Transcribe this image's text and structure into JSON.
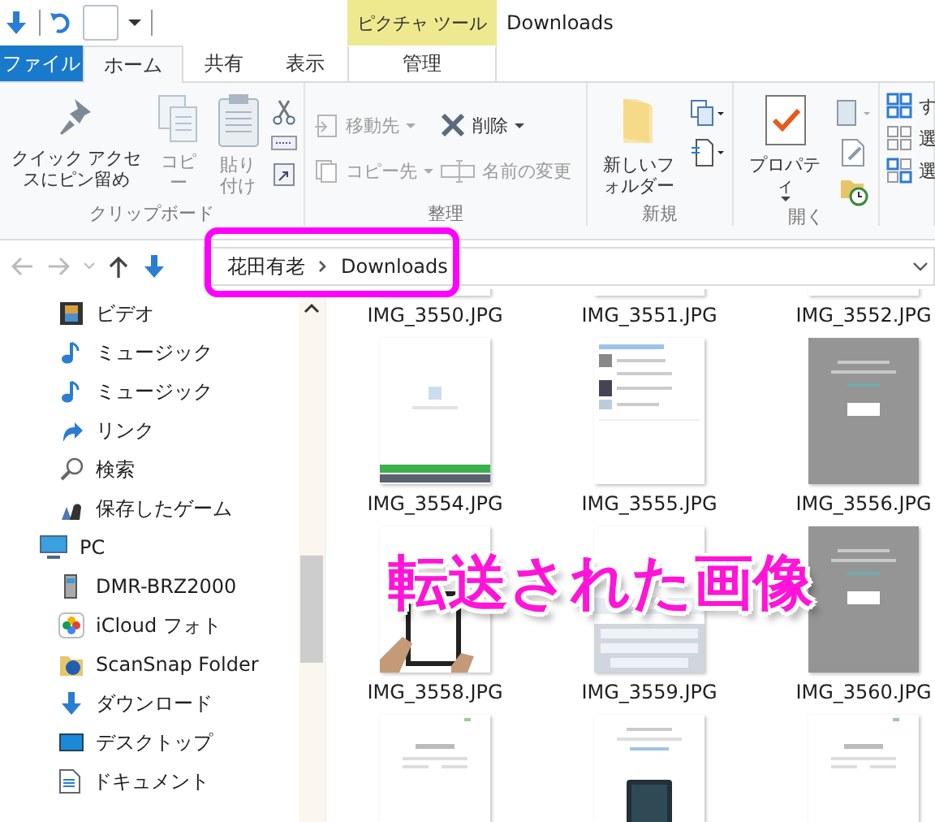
{
  "title_bar": {
    "contextual_group": "ピクチャ ツール",
    "title": "Downloads"
  },
  "tabs": [
    {
      "label": "ファイル",
      "kind": "file",
      "selected": false
    },
    {
      "label": "ホーム",
      "kind": "tab",
      "selected": true
    },
    {
      "label": "共有",
      "kind": "tab",
      "selected": false
    },
    {
      "label": "表示",
      "kind": "tab",
      "selected": false
    },
    {
      "label": "管理",
      "kind": "contextual",
      "selected": false
    }
  ],
  "ribbon": {
    "groups": [
      {
        "label": "クリップボード",
        "buttons": [
          {
            "kind": "large",
            "label": "クイック アクセスにピン留め",
            "disabled": false
          },
          {
            "kind": "large",
            "label": "コピー",
            "disabled": true
          },
          {
            "kind": "large",
            "label": "貼り付け",
            "disabled": true
          },
          {
            "kind": "stack"
          }
        ]
      },
      {
        "label": "整理",
        "buttons": [
          {
            "kind": "small",
            "label": "移動先",
            "dropdown": true,
            "disabled": true
          },
          {
            "kind": "small",
            "label": "コピー先",
            "dropdown": true,
            "disabled": true
          },
          {
            "kind": "small",
            "label": "削除",
            "dropdown": true,
            "disabled": false
          },
          {
            "kind": "small",
            "label": "名前の変更",
            "dropdown": false,
            "disabled": true
          }
        ]
      },
      {
        "label": "新規",
        "buttons": [
          {
            "kind": "large",
            "label": "新しいフォルダー",
            "dropdown": false,
            "disabled": false
          },
          {
            "kind": "stack"
          }
        ]
      },
      {
        "label": "開く",
        "buttons": [
          {
            "kind": "large",
            "label": "プロパティ",
            "dropdown": true,
            "disabled": false
          },
          {
            "kind": "stack"
          }
        ]
      },
      {
        "buttons": [
          {
            "kind": "small",
            "label": "す",
            "disabled": false
          },
          {
            "kind": "small",
            "label": "選",
            "disabled": false
          },
          {
            "kind": "small",
            "label": "選",
            "disabled": false
          }
        ]
      }
    ]
  },
  "address": {
    "breadcrumb": [
      {
        "label": "花田有老"
      },
      {
        "label": "Downloads"
      }
    ]
  },
  "sidebar": {
    "items_above": [
      {
        "label": "ビデオ"
      },
      {
        "label": "ミュージック"
      },
      {
        "label": "ミュージック"
      },
      {
        "label": "リンク"
      },
      {
        "label": "検索"
      },
      {
        "label": "保存したゲーム"
      }
    ],
    "tree": [
      {
        "label": "PC",
        "children": [
          {
            "label": "DMR-BRZ2000"
          },
          {
            "label": "iCloud フォト"
          },
          {
            "label": "ScanSnap Folder"
          },
          {
            "label": "ダウンロード"
          },
          {
            "label": "デスクトップ"
          },
          {
            "label": "ドキュメント"
          }
        ]
      }
    ]
  },
  "files": [
    {
      "kind": "picture",
      "name": "IMG_3550.JPG"
    },
    {
      "kind": "picture",
      "name": "IMG_3551.JPG"
    },
    {
      "kind": "picture",
      "name": "IMG_3552.JPG"
    },
    {
      "kind": "picture",
      "name": "IMG_3554.JPG"
    },
    {
      "kind": "picture",
      "name": "IMG_3555.JPG"
    },
    {
      "kind": "picture",
      "name": "IMG_3556.JPG"
    },
    {
      "kind": "picture",
      "name": "IMG_3558.JPG"
    },
    {
      "kind": "picture",
      "name": "IMG_3559.JPG"
    },
    {
      "kind": "picture",
      "name": "IMG_3560.JPG"
    },
    {
      "kind": "picture"
    },
    {
      "kind": "picture"
    },
    {
      "kind": "picture"
    }
  ],
  "annotation": {
    "callout": "転送された画像"
  }
}
